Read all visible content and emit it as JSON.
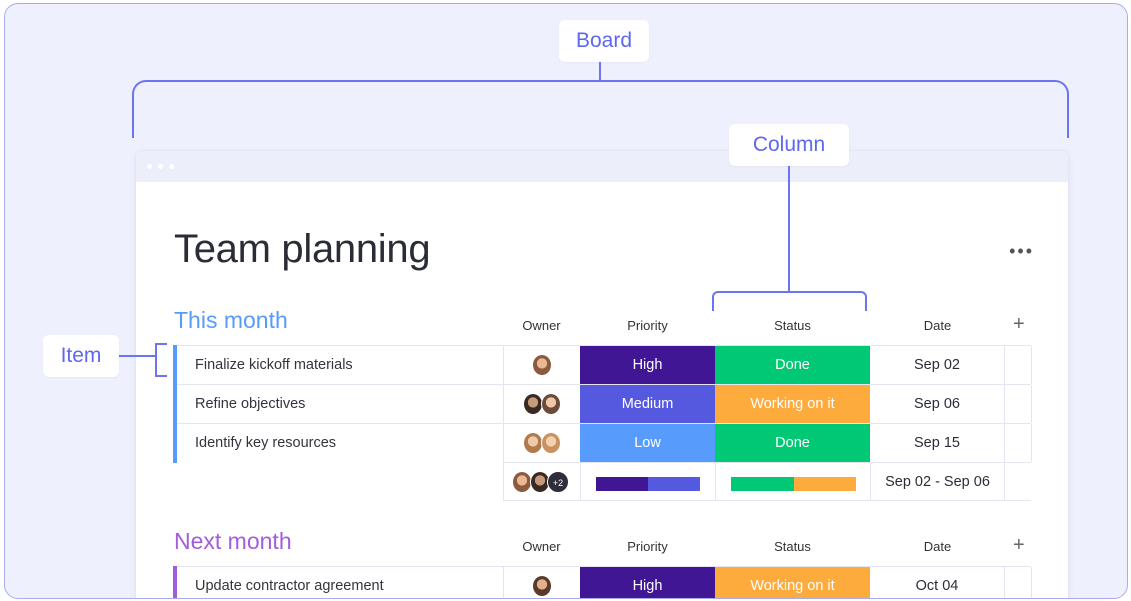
{
  "callouts": {
    "board": "Board",
    "column": "Column",
    "item": "Item"
  },
  "board": {
    "title": "Team planning",
    "more_icon": "more-horizontal-icon",
    "groups": [
      {
        "title": "This month",
        "color": "#579bfc",
        "columns": {
          "owner": "Owner",
          "priority": "Priority",
          "status": "Status",
          "date": "Date",
          "add": "+"
        },
        "items": [
          {
            "name": "Finalize kickoff materials",
            "priority": "High",
            "status": "Done",
            "date": "Sep 02"
          },
          {
            "name": "Refine objectives",
            "priority": "Medium",
            "status": "Working on it",
            "date": "Sep 06"
          },
          {
            "name": "Identify key resources",
            "priority": "Low",
            "status": "Done",
            "date": "Sep 15"
          }
        ],
        "summary": {
          "owner_extra": "+2",
          "date_range": "Sep 02 - Sep 06"
        }
      },
      {
        "title": "Next month",
        "color": "#a25ddc",
        "columns": {
          "owner": "Owner",
          "priority": "Priority",
          "status": "Status",
          "date": "Date",
          "add": "+"
        },
        "items": [
          {
            "name": "Update contractor agreement",
            "priority": "High",
            "status": "Working on it",
            "date": "Oct 04"
          }
        ]
      }
    ]
  },
  "colors": {
    "high": "#401694",
    "medium": "#5559df",
    "low": "#579bfc",
    "done": "#00c875",
    "working": "#fdab3d",
    "annotation": "#5e67f0"
  }
}
